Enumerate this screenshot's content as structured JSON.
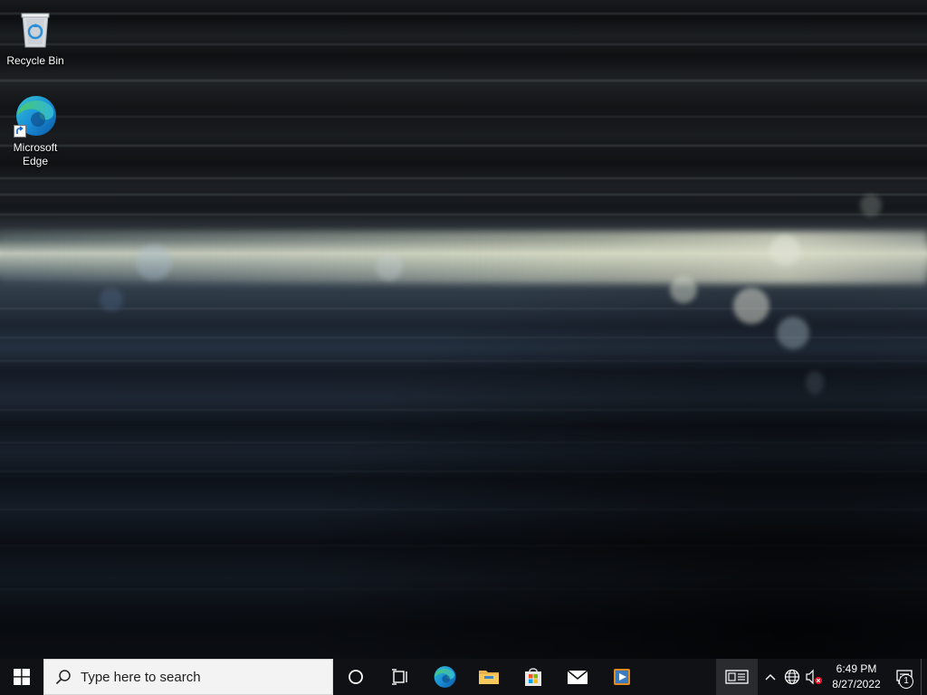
{
  "desktop": {
    "icons": [
      {
        "label": "Recycle Bin",
        "icon": "recycle-bin-icon"
      },
      {
        "label": "Microsoft Edge",
        "icon": "edge-icon",
        "shortcut": true
      }
    ]
  },
  "taskbar": {
    "start_icon": "windows-logo-icon",
    "search": {
      "placeholder": "Type here to search",
      "icon": "search-icon"
    },
    "pinned": [
      {
        "name": "cortana",
        "icon": "cortana-icon"
      },
      {
        "name": "task-view",
        "icon": "task-view-icon"
      },
      {
        "name": "microsoft-edge",
        "icon": "edge-icon"
      },
      {
        "name": "file-explorer",
        "icon": "folder-icon"
      },
      {
        "name": "microsoft-store",
        "icon": "store-icon"
      },
      {
        "name": "mail",
        "icon": "mail-icon"
      },
      {
        "name": "media-player",
        "icon": "media-player-icon"
      }
    ],
    "tray": {
      "news_icon": "news-and-interests-icon",
      "chevron_icon": "chevron-up-icon",
      "network_icon": "globe-network-icon",
      "volume_icon": "volume-muted-icon",
      "time": "6:49 PM",
      "date": "8/27/2022",
      "notification_count": "1"
    }
  },
  "colors": {
    "taskbar_bg": "#101114",
    "search_bg": "#f3f3f3",
    "edge_blue": "#0c59a4",
    "edge_green": "#5ad366"
  }
}
